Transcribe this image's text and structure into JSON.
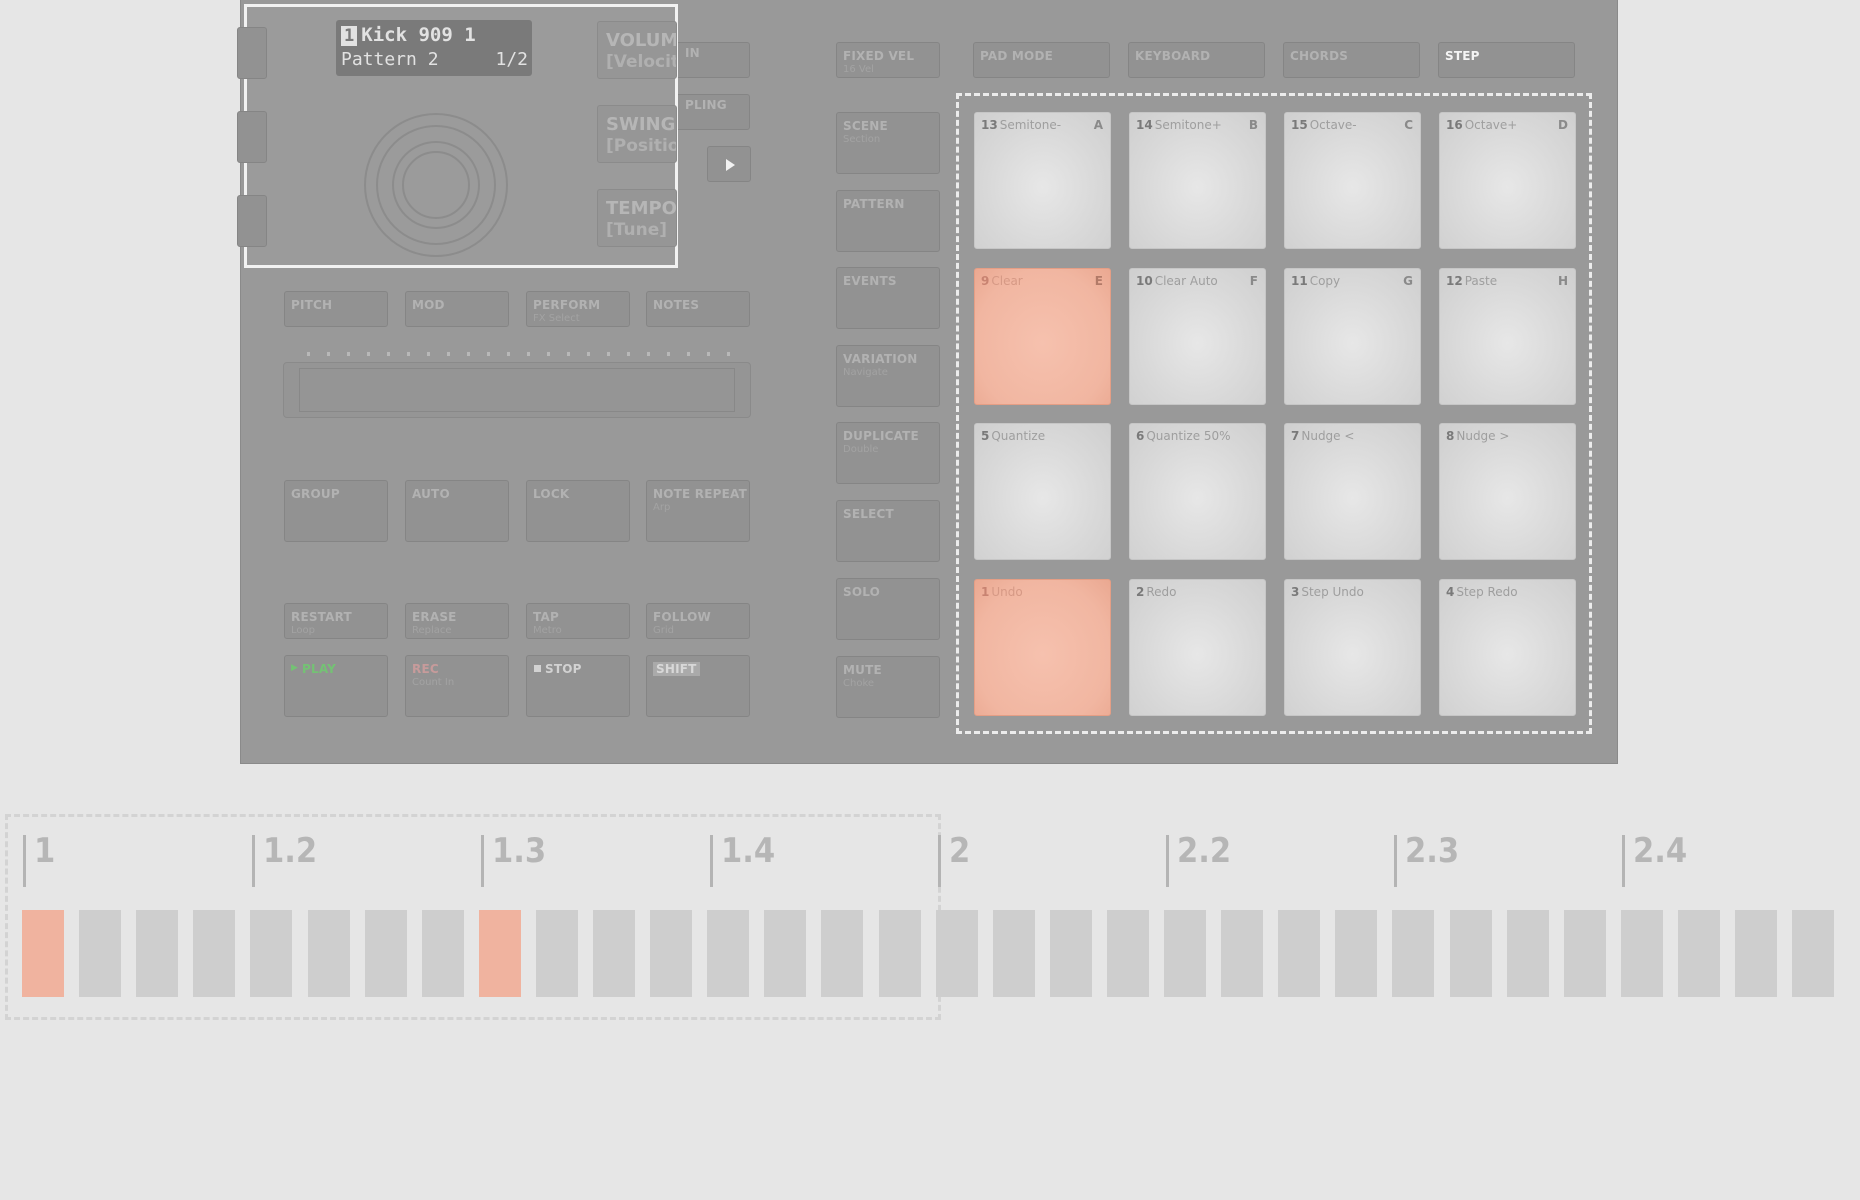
{
  "display": {
    "group_number": "1",
    "sound_name": "Kick 909 1",
    "pattern_name": "Pattern 2",
    "page": "1/2",
    "right_labels": [
      {
        "label": "VOLUME",
        "sub": "[Velocity]"
      },
      {
        "label": "SWING",
        "sub": "[Position]"
      },
      {
        "label": "TEMPO",
        "sub": "[Tune]"
      }
    ]
  },
  "top_partial_buttons": [
    "IN",
    "PLING"
  ],
  "mode_buttons": [
    {
      "label": "PITCH",
      "sub": ""
    },
    {
      "label": "MOD",
      "sub": ""
    },
    {
      "label": "PERFORM",
      "sub": "FX Select"
    },
    {
      "label": "NOTES",
      "sub": ""
    }
  ],
  "edit_buttons": [
    {
      "label": "GROUP",
      "sub": ""
    },
    {
      "label": "AUTO",
      "sub": ""
    },
    {
      "label": "LOCK",
      "sub": ""
    },
    {
      "label": "NOTE REPEAT",
      "sub": "Arp"
    }
  ],
  "transport_top": [
    {
      "label": "RESTART",
      "sub": "Loop"
    },
    {
      "label": "ERASE",
      "sub": "Replace"
    },
    {
      "label": "TAP",
      "sub": "Metro"
    },
    {
      "label": "FOLLOW",
      "sub": "Grid"
    }
  ],
  "transport_bottom": [
    {
      "label": "PLAY",
      "sub": "",
      "color": "#74c274",
      "icon": "play-icon"
    },
    {
      "label": "REC",
      "sub": "Count In",
      "color": "#c79b9b",
      "icon": ""
    },
    {
      "label": "STOP",
      "sub": "",
      "color": "#d2d2d2",
      "icon": "stop-icon"
    },
    {
      "label": "SHIFT",
      "sub": "",
      "color": "#c8c8c8",
      "icon": ""
    }
  ],
  "center_buttons": [
    {
      "label": "FIXED VEL",
      "sub": "16 Vel"
    },
    {
      "label": "SCENE",
      "sub": "Section"
    },
    {
      "label": "PATTERN",
      "sub": ""
    },
    {
      "label": "EVENTS",
      "sub": ""
    },
    {
      "label": "VARIATION",
      "sub": "Navigate"
    },
    {
      "label": "DUPLICATE",
      "sub": "Double"
    },
    {
      "label": "SELECT",
      "sub": ""
    },
    {
      "label": "SOLO",
      "sub": ""
    },
    {
      "label": "MUTE",
      "sub": "Choke"
    }
  ],
  "pad_mode_buttons": [
    {
      "label": "PAD MODE",
      "active": false
    },
    {
      "label": "KEYBOARD",
      "active": false
    },
    {
      "label": "CHORDS",
      "active": false
    },
    {
      "label": "STEP",
      "active": true
    }
  ],
  "pads": [
    {
      "num": "13",
      "name": "Semitone-",
      "letter": "A",
      "lit": false
    },
    {
      "num": "14",
      "name": "Semitone+",
      "letter": "B",
      "lit": false
    },
    {
      "num": "15",
      "name": "Octave-",
      "letter": "C",
      "lit": false
    },
    {
      "num": "16",
      "name": "Octave+",
      "letter": "D",
      "lit": false
    },
    {
      "num": "9",
      "name": "Clear",
      "letter": "E",
      "lit": true
    },
    {
      "num": "10",
      "name": "Clear Auto",
      "letter": "F",
      "lit": false
    },
    {
      "num": "11",
      "name": "Copy",
      "letter": "G",
      "lit": false
    },
    {
      "num": "12",
      "name": "Paste",
      "letter": "H",
      "lit": false
    },
    {
      "num": "5",
      "name": "Quantize",
      "letter": "",
      "lit": false
    },
    {
      "num": "6",
      "name": "Quantize 50%",
      "letter": "",
      "lit": false
    },
    {
      "num": "7",
      "name": "Nudge <",
      "letter": "",
      "lit": false
    },
    {
      "num": "8",
      "name": "Nudge >",
      "letter": "",
      "lit": false
    },
    {
      "num": "1",
      "name": "Undo",
      "letter": "",
      "lit": true
    },
    {
      "num": "2",
      "name": "Redo",
      "letter": "",
      "lit": false
    },
    {
      "num": "3",
      "name": "Step Undo",
      "letter": "",
      "lit": false
    },
    {
      "num": "4",
      "name": "Step Redo",
      "letter": "",
      "lit": false
    }
  ],
  "sequencer": {
    "ruler_labels": [
      "1",
      "1.2",
      "1.3",
      "1.4",
      "2",
      "2.2",
      "2.3",
      "2.4"
    ],
    "steps_lit": [
      1,
      0,
      0,
      0,
      0,
      0,
      0,
      0,
      1,
      0,
      0,
      0,
      0,
      0,
      0,
      0,
      0,
      0,
      0,
      0,
      0,
      0,
      0,
      0,
      0,
      0,
      0,
      0,
      0,
      0,
      0,
      0
    ]
  },
  "colors": {
    "lit_pad": "#f1b6a1",
    "pad": "#d8d8d8",
    "device": "#999999",
    "background": "#e6e6e6"
  }
}
